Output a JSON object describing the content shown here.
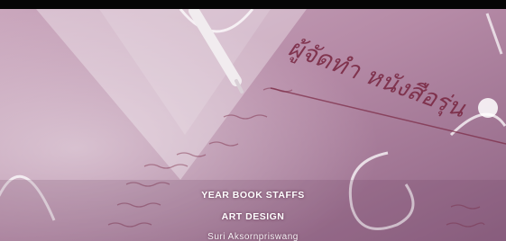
{
  "video_frame": {
    "heading_th": "ผู้จัดทำ หนังสือรุ่น",
    "credits": [
      "YEAR BOOK STAFFS",
      "ART DESIGN",
      "Suri Aksornpriswang"
    ],
    "colors": {
      "background": "#b78aa6",
      "accent": "#7a2a45",
      "top_bar": "#050505"
    }
  }
}
